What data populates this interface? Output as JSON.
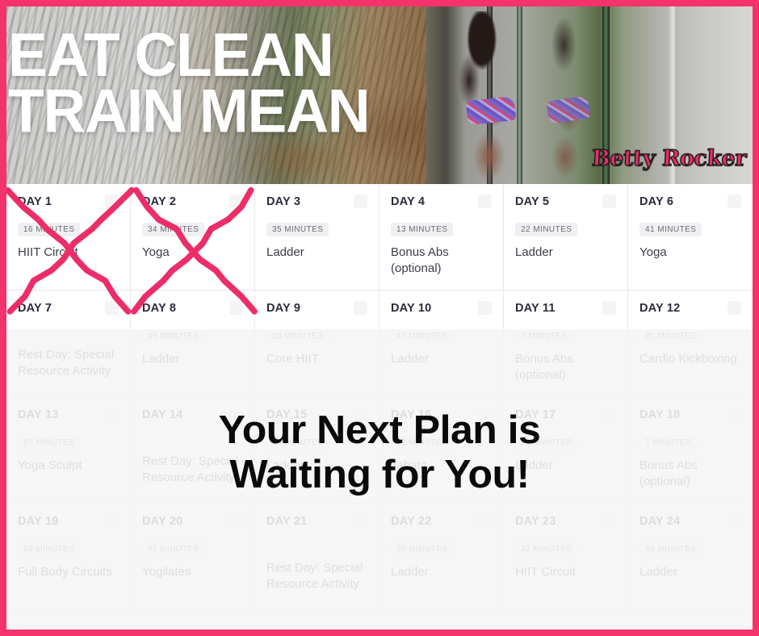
{
  "banner": {
    "headline": "EAT CLEAN\nTRAIN MEAN",
    "watermark": "Betty Rocker"
  },
  "overlay": {
    "caption": "Your Next Plan is\nWaiting for You!"
  },
  "colors": {
    "border_pink": "#f4336d",
    "x_mark_pink": "#ec2d68",
    "day_label": "#2b2b3d",
    "badge_bg": "#f0f0f2",
    "activity_text": "#3d3d4a"
  },
  "calendar": {
    "rows": [
      [
        {
          "day": "DAY 1",
          "duration": "16 MINUTES",
          "activity": "HIIT Circuit",
          "checked": false,
          "crossed_out": true
        },
        {
          "day": "DAY 2",
          "duration": "34 MINUTES",
          "activity": "Yoga",
          "checked": false,
          "crossed_out": true
        },
        {
          "day": "DAY 3",
          "duration": "35 MINUTES",
          "activity": "Ladder",
          "checked": false,
          "crossed_out": false
        },
        {
          "day": "DAY 4",
          "duration": "13 MINUTES",
          "activity": "Bonus Abs\n(optional)",
          "checked": false,
          "crossed_out": false
        },
        {
          "day": "DAY 5",
          "duration": "22 MINUTES",
          "activity": "Ladder",
          "checked": false,
          "crossed_out": false
        },
        {
          "day": "DAY 6",
          "duration": "41 MINUTES",
          "activity": "Yoga",
          "checked": false,
          "crossed_out": false
        }
      ],
      [
        {
          "day": "DAY 7",
          "duration": "",
          "activity": "Rest Day: Special\nResource Activity",
          "checked": false,
          "crossed_out": false
        },
        {
          "day": "DAY 8",
          "duration": "45 MINUTES",
          "activity": "Ladder",
          "checked": false,
          "crossed_out": false
        },
        {
          "day": "DAY 9",
          "duration": "28 MINUTES",
          "activity": "Core HIIT",
          "checked": false,
          "crossed_out": false
        },
        {
          "day": "DAY 10",
          "duration": "47 MINUTES",
          "activity": "Ladder",
          "checked": false,
          "crossed_out": false
        },
        {
          "day": "DAY 11",
          "duration": "7 MINUTES",
          "activity": "Bonus Abs\n(optional)",
          "checked": false,
          "crossed_out": false
        },
        {
          "day": "DAY 12",
          "duration": "31 MINUTES",
          "activity": "Cardio Kickboxing",
          "checked": false,
          "crossed_out": false
        }
      ],
      [
        {
          "day": "DAY 13",
          "duration": "47 MINUTES",
          "activity": "Yoga Sculpt",
          "checked": false,
          "crossed_out": false
        },
        {
          "day": "DAY 14",
          "duration": "",
          "activity": "Rest Day: Special\nResource Activity",
          "checked": false,
          "crossed_out": false
        },
        {
          "day": "DAY 15",
          "duration": "53 MINUTES",
          "activity": "Ladder",
          "checked": false,
          "crossed_out": false
        },
        {
          "day": "DAY 16",
          "duration": "22 MINUTES",
          "activity": "Tabata",
          "checked": false,
          "crossed_out": false
        },
        {
          "day": "DAY 17",
          "duration": "35 MINUTES",
          "activity": "Ladder",
          "checked": false,
          "crossed_out": false
        },
        {
          "day": "DAY 18",
          "duration": "7 MINUTES",
          "activity": "Bonus Abs\n(optional)",
          "checked": false,
          "crossed_out": false
        }
      ],
      [
        {
          "day": "DAY 19",
          "duration": "48 MINUTES",
          "activity": "Full Body Circuits",
          "checked": false,
          "crossed_out": false
        },
        {
          "day": "DAY 20",
          "duration": "42 MINUTES",
          "activity": "Yogilates",
          "checked": false,
          "crossed_out": false
        },
        {
          "day": "DAY 21",
          "duration": "",
          "activity": "Rest Day: Special\nResource Activity",
          "checked": false,
          "crossed_out": false
        },
        {
          "day": "DAY 22",
          "duration": "39 MINUTES",
          "activity": "Ladder",
          "checked": false,
          "crossed_out": false
        },
        {
          "day": "DAY 23",
          "duration": "32 MINUTES",
          "activity": "HIIT Circuit",
          "checked": false,
          "crossed_out": false
        },
        {
          "day": "DAY 24",
          "duration": "46 MINUTES",
          "activity": "Ladder",
          "checked": false,
          "crossed_out": false
        }
      ]
    ]
  }
}
